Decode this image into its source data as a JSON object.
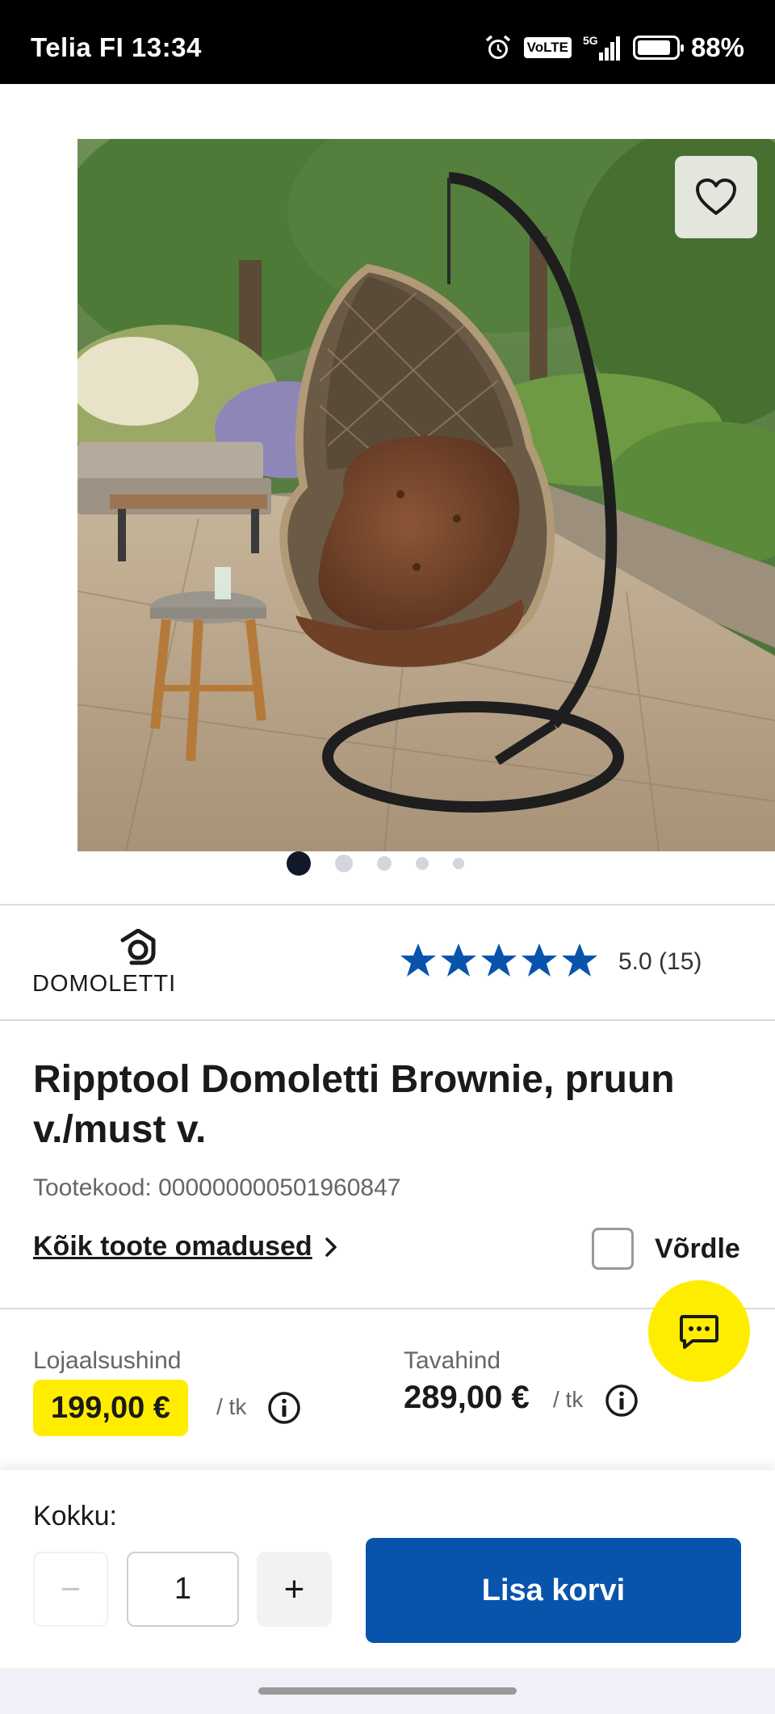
{
  "status_bar": {
    "carrier_time": "Telia FI 13:34",
    "volte": "VoLTE",
    "network": "5G",
    "battery_level": 0.88,
    "battery_text": "88%"
  },
  "gallery": {
    "image_count": 5,
    "active_index": 0,
    "favorite_icon": "heart-icon"
  },
  "brand": {
    "name": "DOMOLETTI"
  },
  "rating": {
    "stars": 5,
    "text": "5.0 (15)",
    "star_color": "#0854ad"
  },
  "product": {
    "title": "Ripptool Domoletti Brownie, pruun v./must v.",
    "sku": "Tootekood: 000000000501960847",
    "features_link": "Kõik toote omadused",
    "compare_label": "Võrdle"
  },
  "prices": {
    "loyalty_label": "Lojaalsushind",
    "loyalty_value": "199,00 €",
    "loyalty_unit": "/ tk",
    "regular_label": "Tavahind",
    "regular_value": "289,00 €",
    "regular_unit": "/ tk",
    "highlight_color": "#ffed00"
  },
  "cart": {
    "total_label": "Kokku:",
    "minus": "−",
    "quantity": "1",
    "plus": "+",
    "add_button": "Lisa korvi",
    "button_color": "#0854ad"
  }
}
